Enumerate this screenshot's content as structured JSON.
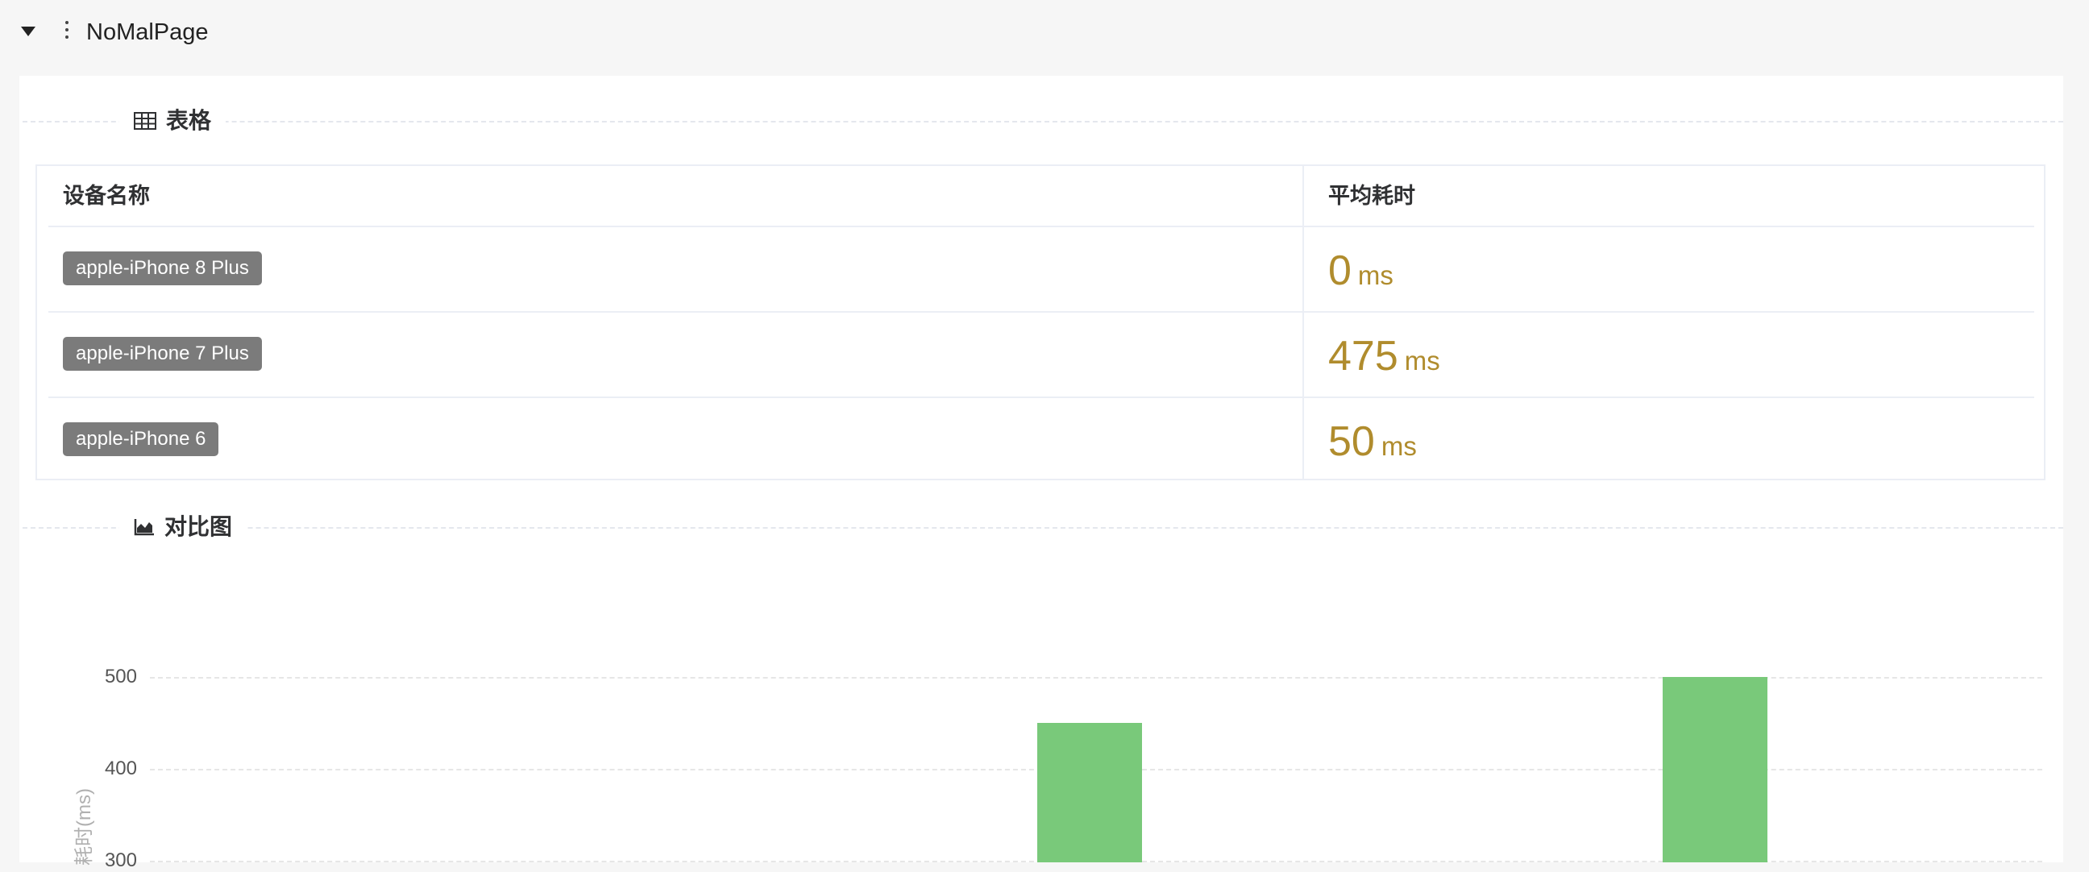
{
  "header": {
    "title": "NoMalPage",
    "collapse_icon": "caret-down-icon",
    "menu_icon": "vertical-dots-icon"
  },
  "table_section": {
    "title": "表格",
    "icon": "table-icon",
    "columns": [
      "设备名称",
      "平均耗时"
    ],
    "rows": [
      {
        "device": "apple-iPhone 8 Plus",
        "avg": "0",
        "unit": "ms"
      },
      {
        "device": "apple-iPhone 7 Plus",
        "avg": "475",
        "unit": "ms"
      },
      {
        "device": "apple-iPhone 6",
        "avg": "50",
        "unit": "ms"
      }
    ]
  },
  "chart_section": {
    "title": "对比图",
    "icon": "area-chart-icon"
  },
  "colors": {
    "metric_value": "#b08c2d",
    "bar_fill": "#79c97a",
    "tag_bg": "#7b7b7b"
  },
  "chart_data": {
    "type": "bar",
    "ylabel": "耗时(ms)",
    "yticks": [
      "500",
      "400",
      "300"
    ],
    "ylim": [
      0,
      500
    ],
    "grid": true,
    "series": [
      {
        "values": [
          450,
          500
        ]
      }
    ]
  }
}
